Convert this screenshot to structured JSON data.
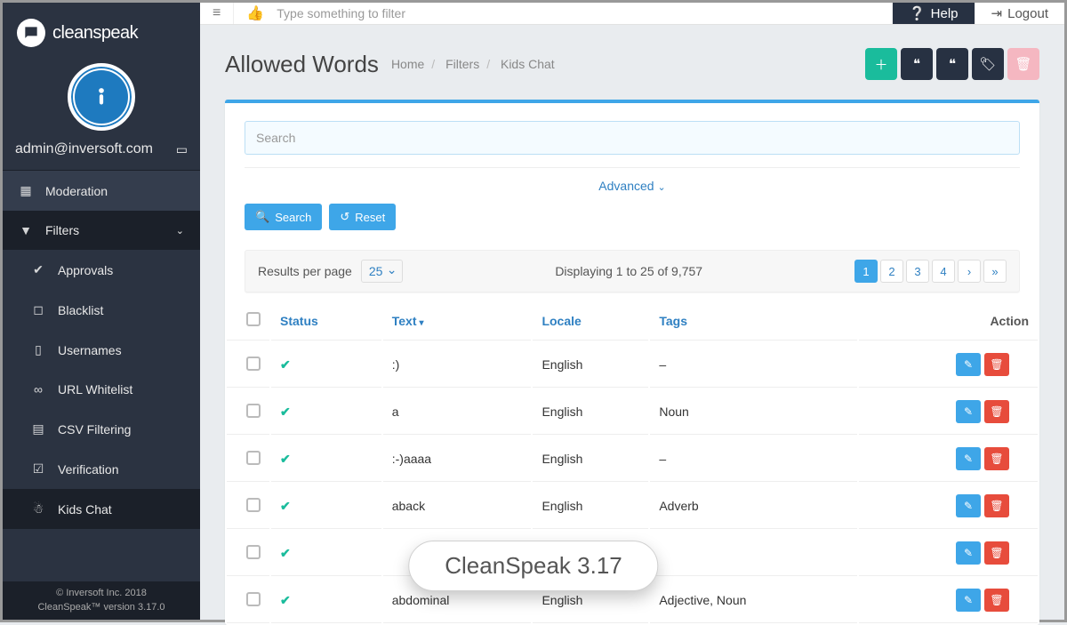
{
  "brand": "cleanspeak",
  "user_email": "admin@inversoft.com",
  "footer": {
    "line1": "© Inversoft Inc. 2018",
    "line2": "CleanSpeak™ version 3.17.0"
  },
  "topbar": {
    "filter_placeholder": "Type something to filter",
    "help": "Help",
    "logout": "Logout"
  },
  "sidebar": {
    "moderation": "Moderation",
    "filters": "Filters",
    "items": [
      {
        "label": "Approvals"
      },
      {
        "label": "Blacklist"
      },
      {
        "label": "Usernames"
      },
      {
        "label": "URL Whitelist"
      },
      {
        "label": "CSV Filtering"
      },
      {
        "label": "Verification"
      },
      {
        "label": "Kids Chat"
      }
    ]
  },
  "page": {
    "title": "Allowed Words",
    "crumbs": [
      "Home",
      "Filters",
      "Kids Chat"
    ]
  },
  "search": {
    "placeholder": "Search",
    "advanced": "Advanced",
    "search_btn": "Search",
    "reset_btn": "Reset"
  },
  "results": {
    "rpp_label": "Results per page",
    "rpp_value": "25",
    "displaying": "Displaying 1 to 25 of 9,757",
    "pages": [
      "1",
      "2",
      "3",
      "4"
    ]
  },
  "table": {
    "headers": {
      "status": "Status",
      "text": "Text",
      "locale": "Locale",
      "tags": "Tags",
      "action": "Action"
    },
    "rows": [
      {
        "text": ":)",
        "locale": "English",
        "tags": "–"
      },
      {
        "text": "a",
        "locale": "English",
        "tags": "Noun"
      },
      {
        "text": ":-)aaaa",
        "locale": "English",
        "tags": "–"
      },
      {
        "text": "aback",
        "locale": "English",
        "tags": "Adverb"
      },
      {
        "text": "",
        "locale": "",
        "tags": ""
      },
      {
        "text": "abdominal",
        "locale": "English",
        "tags": "Adjective, Noun"
      }
    ]
  },
  "overlay": "CleanSpeak 3.17"
}
